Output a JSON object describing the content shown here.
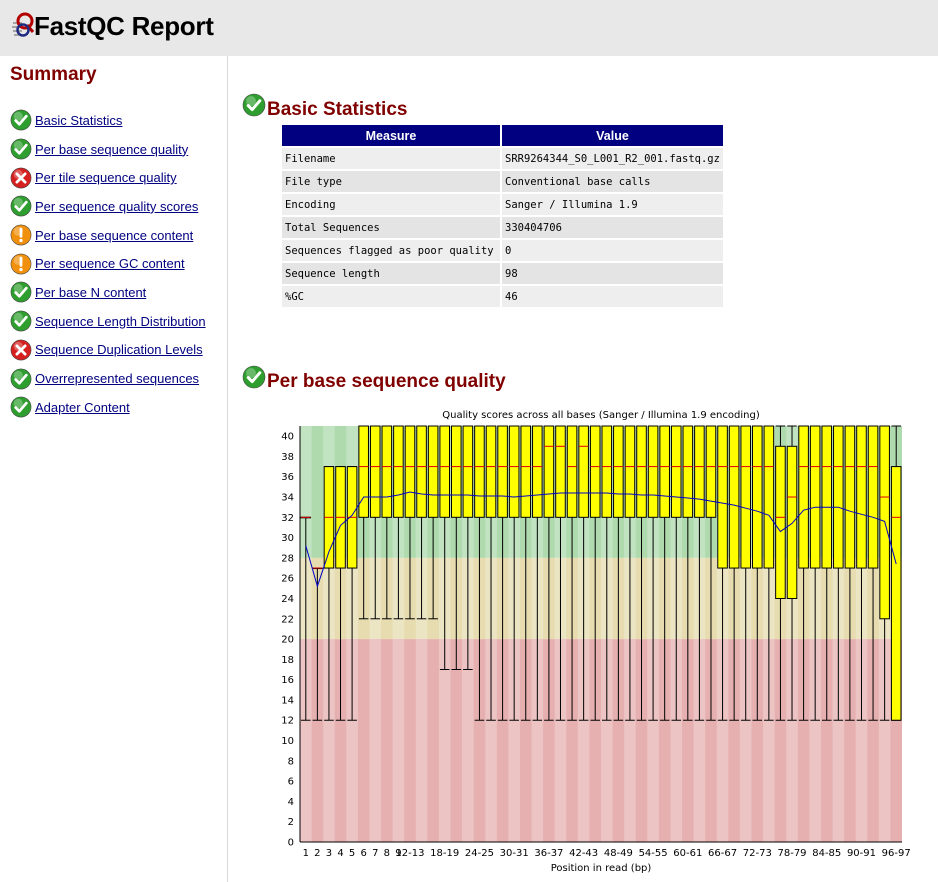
{
  "header": {
    "title": "FastQC Report"
  },
  "summary": {
    "title": "Summary",
    "items": [
      {
        "label": "Basic Statistics",
        "status": "pass"
      },
      {
        "label": "Per base sequence quality",
        "status": "pass"
      },
      {
        "label": "Per tile sequence quality",
        "status": "fail"
      },
      {
        "label": "Per sequence quality scores",
        "status": "pass"
      },
      {
        "label": "Per base sequence content",
        "status": "warn"
      },
      {
        "label": "Per sequence GC content",
        "status": "warn"
      },
      {
        "label": "Per base N content",
        "status": "pass"
      },
      {
        "label": "Sequence Length Distribution",
        "status": "pass"
      },
      {
        "label": "Sequence Duplication Levels",
        "status": "fail"
      },
      {
        "label": "Overrepresented sequences",
        "status": "pass"
      },
      {
        "label": "Adapter Content",
        "status": "pass"
      }
    ]
  },
  "status_colors": {
    "pass": "#2e9e2e",
    "warn": "#f0900c",
    "fail": "#d62020"
  },
  "basic_stats": {
    "title": "Basic Statistics",
    "status": "pass",
    "headers": [
      "Measure",
      "Value"
    ],
    "rows": [
      [
        "Filename",
        "SRR9264344_S0_L001_R2_001.fastq.gz"
      ],
      [
        "File type",
        "Conventional base calls"
      ],
      [
        "Encoding",
        "Sanger / Illumina 1.9"
      ],
      [
        "Total Sequences",
        "330404706"
      ],
      [
        "Sequences flagged as poor quality",
        "0"
      ],
      [
        "Sequence length",
        "98"
      ],
      [
        "%GC",
        "46"
      ]
    ]
  },
  "per_base_quality": {
    "title": "Per base sequence quality",
    "status": "pass"
  },
  "chart_data": {
    "type": "box",
    "title": "Quality scores across all bases (Sanger / Illumina 1.9 encoding)",
    "xlabel": "Position in read (bp)",
    "ylabel": "",
    "ylim": [
      0,
      41
    ],
    "yticks": [
      0,
      2,
      4,
      6,
      8,
      10,
      12,
      14,
      16,
      18,
      20,
      22,
      24,
      26,
      28,
      30,
      32,
      34,
      36,
      38,
      40
    ],
    "zones": [
      {
        "from": 28,
        "to": 41,
        "color": "#aedaae"
      },
      {
        "from": 20,
        "to": 28,
        "color": "#e6dcb0"
      },
      {
        "from": 0,
        "to": 20,
        "color": "#e6b0b0"
      }
    ],
    "categories": [
      "1",
      "2",
      "3",
      "4",
      "5",
      "6",
      "7",
      "8",
      "9",
      "12-13",
      "14-15",
      "16-17",
      "18-19",
      "20-21",
      "22-23",
      "24-25",
      "26-27",
      "28-29",
      "30-31",
      "32-33",
      "34-35",
      "36-37",
      "38-39",
      "40-41",
      "42-43",
      "44-45",
      "46-47",
      "48-49",
      "50-51",
      "52-53",
      "54-55",
      "56-57",
      "58-59",
      "60-61",
      "62-63",
      "64-65",
      "66-67",
      "68-69",
      "70-71",
      "72-73",
      "74-75",
      "76-77",
      "78-79",
      "80-81",
      "82-83",
      "84-85",
      "86-87",
      "88-89",
      "90-91",
      "92-93",
      "94-95",
      "96-97"
    ],
    "x_tick_labels": [
      "1",
      "2",
      "3",
      "4",
      "5",
      "6",
      "7",
      "8",
      "9",
      "12-13",
      "18-19",
      "24-25",
      "30-31",
      "36-37",
      "42-43",
      "48-49",
      "54-55",
      "60-61",
      "66-67",
      "72-73",
      "78-79",
      "84-85",
      "90-91",
      "96-97"
    ],
    "series": [
      {
        "name": "Lower whisker",
        "values": [
          12,
          12,
          12,
          12,
          12,
          22,
          22,
          22,
          22,
          22,
          22,
          22,
          17,
          17,
          17,
          12,
          12,
          12,
          12,
          12,
          12,
          12,
          12,
          12,
          12,
          12,
          12,
          12,
          12,
          12,
          12,
          12,
          12,
          12,
          12,
          12,
          12,
          12,
          12,
          12,
          12,
          12,
          12,
          12,
          12,
          12,
          12,
          12,
          12,
          12,
          12,
          12
        ]
      },
      {
        "name": "Lower quartile",
        "values": [
          32,
          27,
          27,
          27,
          27,
          32,
          32,
          32,
          32,
          32,
          32,
          32,
          32,
          32,
          32,
          32,
          32,
          32,
          32,
          32,
          32,
          32,
          32,
          32,
          32,
          32,
          32,
          32,
          32,
          32,
          32,
          32,
          32,
          32,
          32,
          32,
          27,
          27,
          27,
          27,
          27,
          24,
          24,
          27,
          27,
          27,
          27,
          27,
          27,
          27,
          22,
          12
        ]
      },
      {
        "name": "Median",
        "values": [
          32,
          27,
          32,
          32,
          32,
          37,
          37,
          37,
          37,
          37,
          37,
          37,
          37,
          37,
          37,
          37,
          37,
          37,
          37,
          37,
          37,
          39,
          39,
          37,
          39,
          37,
          37,
          37,
          37,
          37,
          37,
          37,
          37,
          37,
          37,
          37,
          37,
          37,
          37,
          37,
          37,
          32,
          34,
          37,
          37,
          37,
          37,
          37,
          37,
          37,
          34,
          32
        ]
      },
      {
        "name": "Upper quartile",
        "values": [
          32,
          27,
          37,
          37,
          37,
          41,
          41,
          41,
          41,
          41,
          41,
          41,
          41,
          41,
          41,
          41,
          41,
          41,
          41,
          41,
          41,
          41,
          41,
          41,
          41,
          41,
          41,
          41,
          41,
          41,
          41,
          41,
          41,
          41,
          41,
          41,
          41,
          41,
          41,
          41,
          41,
          39,
          39,
          41,
          41,
          41,
          41,
          41,
          41,
          41,
          41,
          37
        ]
      },
      {
        "name": "Upper whisker",
        "values": [
          32,
          27,
          37,
          37,
          37,
          41,
          41,
          41,
          41,
          41,
          41,
          41,
          41,
          41,
          41,
          41,
          41,
          41,
          41,
          41,
          41,
          41,
          41,
          41,
          41,
          41,
          41,
          41,
          41,
          41,
          41,
          41,
          41,
          41,
          41,
          41,
          41,
          41,
          41,
          41,
          41,
          41,
          41,
          41,
          41,
          41,
          41,
          41,
          41,
          41,
          41,
          41
        ]
      },
      {
        "name": "Mean",
        "values": [
          29.2,
          25.2,
          28.6,
          31.2,
          32.2,
          34.0,
          34.0,
          34.0,
          34.2,
          34.5,
          34.3,
          34.2,
          34.2,
          34.2,
          34.2,
          34.1,
          34.1,
          34.1,
          34.0,
          34.1,
          34.2,
          34.3,
          34.4,
          34.4,
          34.4,
          34.4,
          34.4,
          34.3,
          34.3,
          34.2,
          34.2,
          34.1,
          34.0,
          33.9,
          33.8,
          33.6,
          33.4,
          33.2,
          32.9,
          32.6,
          32.2,
          30.6,
          31.4,
          32.7,
          33.0,
          33.0,
          33.0,
          32.6,
          32.3,
          32.0,
          31.6,
          27.4
        ]
      }
    ]
  }
}
